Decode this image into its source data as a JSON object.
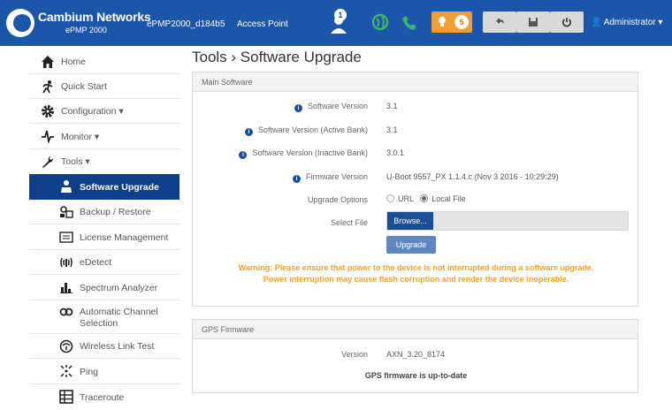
{
  "header": {
    "brand": "Cambium Networks",
    "brand_sub": "ePMP 2000",
    "device_name": "ePMP2000_d184b5",
    "device_mode": "Access Point",
    "notification_count": "1",
    "alarm_count": "5",
    "user": "Administrator",
    "colors": {
      "bar": "#1b56a8",
      "alarm": "#f0a033",
      "status_ok": "#3cb371"
    }
  },
  "sidebar": {
    "items": [
      {
        "label": "Home",
        "icon": "home-icon"
      },
      {
        "label": "Quick Start",
        "icon": "running-person-icon"
      },
      {
        "label": "Configuration ▾",
        "icon": "gear-icon"
      },
      {
        "label": "Monitor ▾",
        "icon": "pulse-icon"
      },
      {
        "label": "Tools ▾",
        "icon": "wrench-icon"
      },
      {
        "label": "Software Upgrade",
        "icon": "upgrade-icon",
        "active": true
      },
      {
        "label": "Backup / Restore",
        "icon": "backup-icon"
      },
      {
        "label": "License Management",
        "icon": "license-icon"
      },
      {
        "label": "eDetect",
        "icon": "edetect-icon"
      },
      {
        "label": "Spectrum Analyzer",
        "icon": "spectrum-icon"
      },
      {
        "label": "Automatic Channel Selection",
        "icon": "channel-icon"
      },
      {
        "label": "Wireless Link Test",
        "icon": "link-test-icon"
      },
      {
        "label": "Ping",
        "icon": "ping-icon"
      },
      {
        "label": "Traceroute",
        "icon": "traceroute-icon"
      }
    ]
  },
  "main": {
    "title": "Tools › Software Upgrade",
    "software_panel": {
      "heading": "Main Software",
      "rows": [
        {
          "label": "Software Version",
          "value": "3.1"
        },
        {
          "label": "Software Version (Active Bank)",
          "value": "3.1"
        },
        {
          "label": "Software Version (Inactive Bank)",
          "value": "3.0.1"
        },
        {
          "label": "Firmware Version",
          "value": "U-Boot 9557_PX 1.1.4.c (Nov 3 2016 - 10:29:29)"
        }
      ],
      "upgrade_options_label": "Upgrade Options",
      "option_url": "URL",
      "option_local": "Local File",
      "select_file_label": "Select File",
      "browse_label": "Browse...",
      "upgrade_label": "Upgrade",
      "warning": "Warning: Please ensure that power to the device is not interrupted during a software upgrade. Power interruption may cause flash corruption and render the device inoperable."
    },
    "gps_panel": {
      "heading": "GPS Firmware",
      "version_label": "Version",
      "version_value": "AXN_3.20_8174",
      "status": "GPS firmware is up-to-date"
    }
  }
}
